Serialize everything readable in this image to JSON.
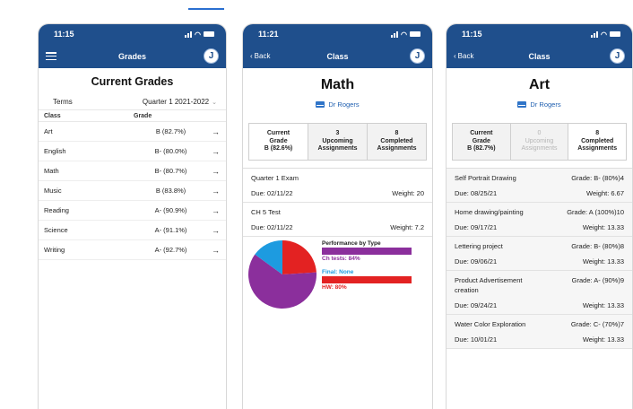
{
  "colors": {
    "nav": "#1f4f8c",
    "link": "#1f5fb0",
    "ch_tests": "#8b2f9c",
    "hw": "#e32222",
    "final": "#1d9be0"
  },
  "screen_grades": {
    "status_time": "11:15",
    "nav_title": "Grades",
    "avatar": "J",
    "title": "Current Grades",
    "terms_label": "Terms",
    "terms_value": "Quarter 1 2021-2022",
    "col_class": "Class",
    "col_grade": "Grade",
    "rows": [
      {
        "class": "Art",
        "grade": "B (82.7%)"
      },
      {
        "class": "English",
        "grade": "B- (80.0%)"
      },
      {
        "class": "Math",
        "grade": "B- (80.7%)"
      },
      {
        "class": "Music",
        "grade": "B (83.8%)"
      },
      {
        "class": "Reading",
        "grade": "A- (90.9%)"
      },
      {
        "class": "Science",
        "grade": "A- (91.1%)"
      },
      {
        "class": "Writing",
        "grade": "A- (92.7%)"
      }
    ],
    "row_arrow": "→"
  },
  "screen_math": {
    "status_time": "11:21",
    "back_label": "Back",
    "nav_title": "Class",
    "avatar": "J",
    "title": "Math",
    "teacher": "Dr Rogers",
    "seg": [
      {
        "line1": "Current",
        "line2": "Grade",
        "line3": "B (82.6%)"
      },
      {
        "line1": "3",
        "line2": "Upcoming",
        "line3": "Assignments"
      },
      {
        "line1": "8",
        "line2": "Completed",
        "line3": "Assignments"
      }
    ],
    "assignments": [
      {
        "name": "Quarter 1 Exam",
        "due": "Due: 02/11/22",
        "weight": "Weight: 20"
      },
      {
        "name": "CH 5 Test",
        "due": "Due: 02/11/22",
        "weight": "Weight: 7.2"
      }
    ],
    "chart_data": {
      "type": "pie",
      "title": "Performance by Type",
      "slices": [
        {
          "name": "Ch tests",
          "value": 61
        },
        {
          "name": "Final",
          "value": 15
        },
        {
          "name": "HW",
          "value": 24
        }
      ],
      "legend": [
        {
          "label": "Ch tests: 84%"
        },
        {
          "label": "Final: None"
        },
        {
          "label": "HW: 80%"
        }
      ]
    }
  },
  "screen_art": {
    "status_time": "11:15",
    "back_label": "Back",
    "nav_title": "Class",
    "avatar": "J",
    "title": "Art",
    "teacher": "Dr Rogers",
    "seg": [
      {
        "line1": "Current",
        "line2": "Grade",
        "line3": "B (82.7%)"
      },
      {
        "line1": "0",
        "line2": "Upcoming",
        "line3": "Assignments"
      },
      {
        "line1": "8",
        "line2": "Completed",
        "line3": "Assignments"
      }
    ],
    "assignments": [
      {
        "name": "Self Portrait Drawing",
        "grade": "Grade: B- (80%)4",
        "due": "Due: 08/25/21",
        "weight": "Weight: 6.67"
      },
      {
        "name": "Home drawing/painting",
        "grade": "Grade: A (100%)10",
        "due": "Due: 09/17/21",
        "weight": "Weight: 13.33"
      },
      {
        "name": "Lettering project",
        "grade": "Grade: B- (80%)8",
        "due": "Due: 09/06/21",
        "weight": "Weight: 13.33"
      },
      {
        "name": "Product Advertisement creation",
        "grade": "Grade: A- (90%)9",
        "due": "Due: 09/24/21",
        "weight": "Weight: 13.33"
      },
      {
        "name": "Water Color Exploration",
        "grade": "Grade: C- (70%)7",
        "due": "Due: 10/01/21",
        "weight": "Weight: 13.33"
      }
    ]
  }
}
